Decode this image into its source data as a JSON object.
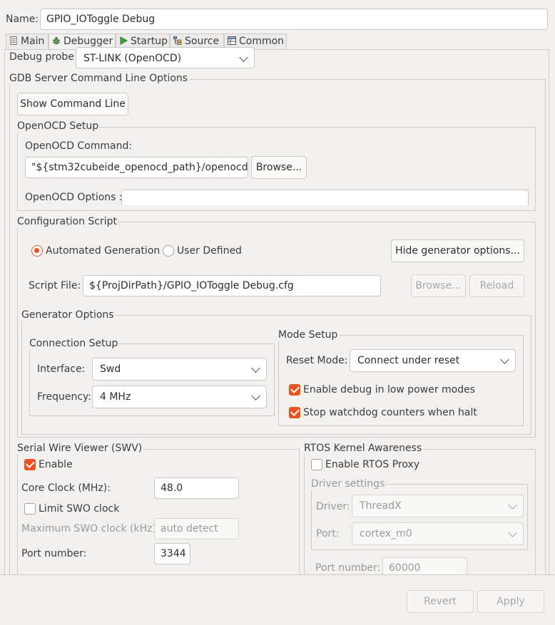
{
  "name": {
    "label": "Name:",
    "value": "GPIO_IOToggle Debug"
  },
  "tabs": [
    {
      "label": "Main",
      "icon": "document-icon"
    },
    {
      "label": "Debugger",
      "icon": "bug-icon"
    },
    {
      "label": "Startup",
      "icon": "play-icon"
    },
    {
      "label": "Source",
      "icon": "source-tree-icon"
    },
    {
      "label": "Common",
      "icon": "common-table-icon"
    }
  ],
  "debug_probe": {
    "label": "Debug probe",
    "value": "ST-LINK (OpenOCD)"
  },
  "gdb": {
    "title": "GDB Server Command Line Options",
    "show_cmd_button": "Show Command Line",
    "openocd_setup": {
      "title": "OpenOCD Setup",
      "command_label": "OpenOCD Command:",
      "command_value": "\"${stm32cubeide_openocd_path}/openocd\"",
      "browse_button": "Browse...",
      "options_label": "OpenOCD Options :",
      "options_value": ""
    },
    "config_script": {
      "title": "Configuration Script",
      "auto_gen_label": "Automated Generation",
      "user_defined_label": "User Defined",
      "hide_gen_button": "Hide generator options...",
      "script_file_label": "Script File:",
      "script_file_value": "${ProjDirPath}/GPIO_IOToggle Debug.cfg",
      "browse_button": "Browse...",
      "reload_button": "Reload",
      "generator": {
        "title": "Generator Options",
        "connection": {
          "title": "Connection Setup",
          "interface_label": "Interface:",
          "interface_value": "Swd",
          "frequency_label": "Frequency:",
          "frequency_value": "4 MHz"
        },
        "mode": {
          "title": "Mode Setup",
          "reset_label": "Reset Mode:",
          "reset_value": "Connect under reset",
          "low_power_label": "Enable debug in low power modes",
          "watchdog_label": "Stop watchdog counters when halt"
        }
      }
    }
  },
  "swv": {
    "title": "Serial Wire Viewer (SWV)",
    "enable_label": "Enable",
    "core_clock_label": "Core Clock (MHz):",
    "core_clock_value": "48.0",
    "limit_swo_label": "Limit SWO clock",
    "max_swo_label": "Maximum SWO clock (kHz):",
    "max_swo_value": "auto detect",
    "port_label": "Port number:",
    "port_value": "3344"
  },
  "rtos": {
    "title": "RTOS Kernel Awareness",
    "enable_proxy_label": "Enable RTOS Proxy",
    "driver_settings": {
      "title": "Driver settings",
      "driver_label": "Driver:",
      "driver_value": "ThreadX",
      "port_label": "Port:",
      "port_value": "cortex_m0"
    },
    "port_number_label": "Port number:",
    "port_number_value": "60000"
  },
  "footer": {
    "revert_button": "Revert",
    "apply_button": "Apply"
  },
  "colors": {
    "accent": "#e95420",
    "background": "#f2f1f0",
    "border": "#cfcac5"
  }
}
